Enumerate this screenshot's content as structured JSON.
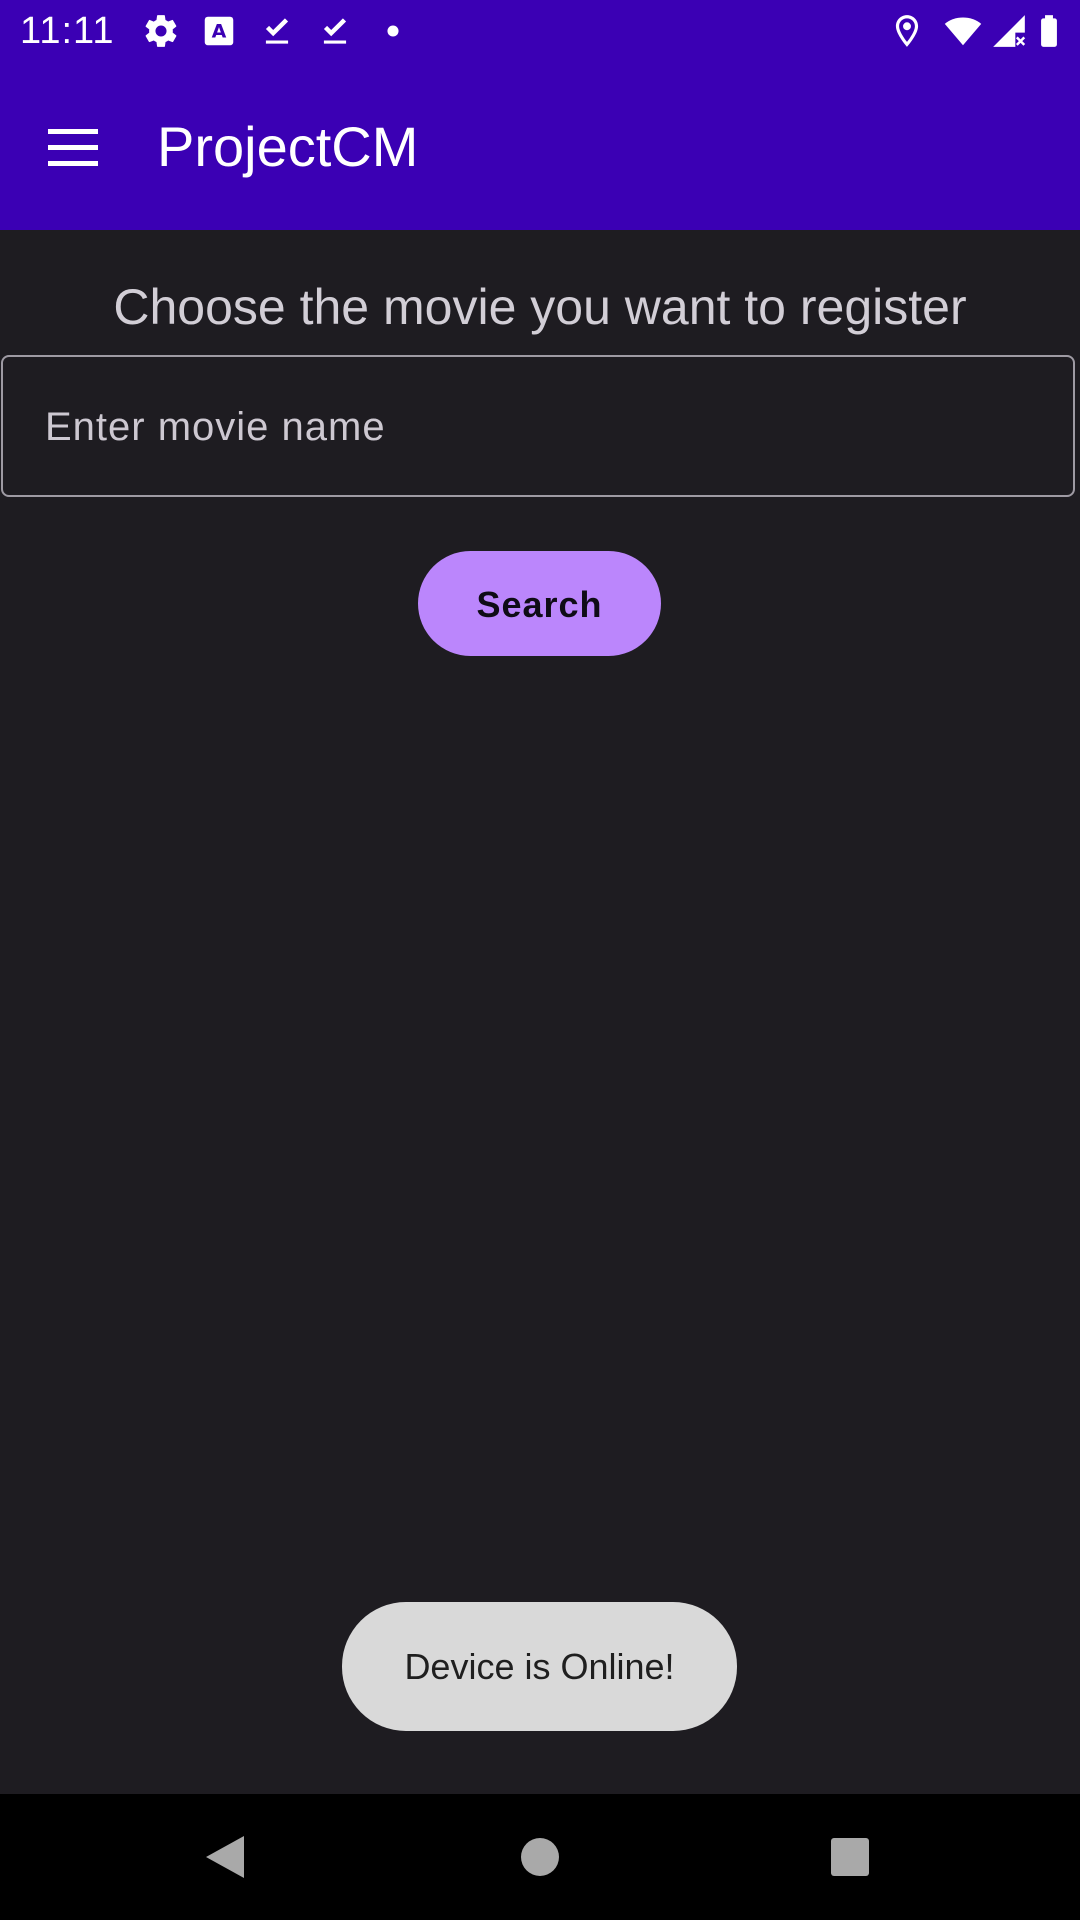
{
  "status_bar": {
    "time": "11:11",
    "left_icons": [
      "settings-icon",
      "text-a-icon",
      "download-done-icon",
      "download-done-icon",
      "dot-icon"
    ],
    "right_icons": [
      "location-icon",
      "wifi-icon",
      "cell-signal-icon",
      "battery-icon"
    ],
    "background": "#3b00b4"
  },
  "app_bar": {
    "title": "ProjectCM",
    "menu_icon": "hamburger-menu-icon",
    "background": "#3b00b4"
  },
  "main": {
    "heading": "Choose the movie you want to register",
    "search_input": {
      "value": "",
      "placeholder": "Enter movie name"
    },
    "search_button_label": "Search",
    "accent_color": "#bb86fc"
  },
  "toast": {
    "message": "Device is Online!"
  },
  "nav_bar": {
    "buttons": [
      "back-icon",
      "home-icon",
      "recents-icon"
    ]
  }
}
